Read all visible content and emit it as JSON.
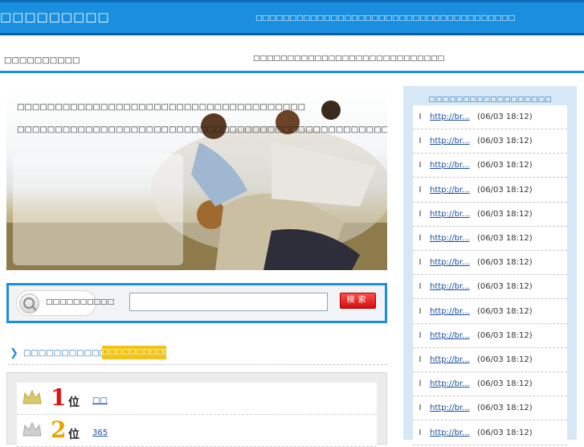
{
  "header": {
    "site_title": "□□□□□□□□□",
    "tagline": "□□□□□□□□□□□□□□□□□□□□□□□□□□□□□□□□□□□□□□",
    "sub_left": "□□□□□□□□□□",
    "sub_center": "□□□□□□□□□□□□□□□□□□□□□□□□□□□□"
  },
  "hero": {
    "text1": "□□□□□□□□□□□□□□□□□□□□□□□□□□□□□□□□□□□□□□",
    "text2": "□□□□□□□□□□□□□□□□□□□□□□□□□□□□□□□□□□□□□□□□□□□□□□□□□□□□□□□□□□□□□□□□□□□□□□□□□□□□□□"
  },
  "search": {
    "label": "□□□□□□□□□□",
    "placeholder": "",
    "button": "検索"
  },
  "ranking": {
    "title": "□□□□□□□□□□□□□□□□",
    "badge": "□□□□□□□□□□□□",
    "items": [
      {
        "rank": "1",
        "suffix": "位",
        "link": "□□",
        "color": "#e01010"
      },
      {
        "rank": "2",
        "suffix": "位",
        "link": "365",
        "color": "#e8a400"
      }
    ]
  },
  "sidebar": {
    "title": "□□□□□□□□□□□□□□□□□□",
    "items": [
      {
        "link": "http://br...",
        "date": "(06/03 18:12)"
      },
      {
        "link": "http://br...",
        "date": "(06/03 18:12)"
      },
      {
        "link": "http://br...",
        "date": "(06/03 18:12)"
      },
      {
        "link": "http://br...",
        "date": "(06/03 18:12)"
      },
      {
        "link": "http://br...",
        "date": "(06/03 18:12)"
      },
      {
        "link": "http://br...",
        "date": "(06/03 18:12)"
      },
      {
        "link": "http://br...",
        "date": "(06/03 18:12)"
      },
      {
        "link": "http://br...",
        "date": "(06/03 18:12)"
      },
      {
        "link": "http://br...",
        "date": "(06/03 18:12)"
      },
      {
        "link": "http://br...",
        "date": "(06/03 18:12)"
      },
      {
        "link": "http://br...",
        "date": "(06/03 18:12)"
      },
      {
        "link": "http://br...",
        "date": "(06/03 18:12)"
      },
      {
        "link": "http://br...",
        "date": "(06/03 18:12)"
      },
      {
        "link": "http://br...",
        "date": "(06/03 18:12)"
      }
    ]
  },
  "colors": {
    "accent": "#1b8fdf",
    "search_button": "#e01010",
    "badge": "#f0c419"
  }
}
